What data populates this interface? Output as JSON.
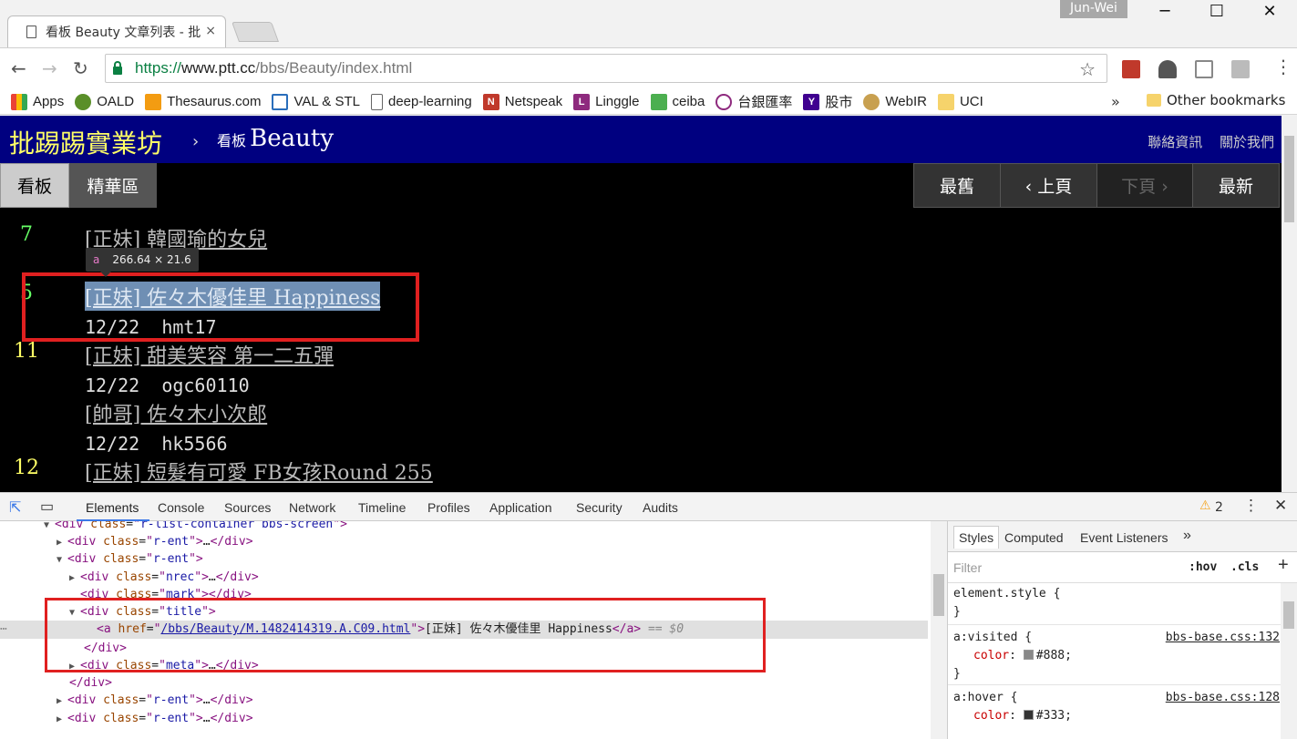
{
  "browser": {
    "tab_title": "看板 Beauty 文章列表 - 批",
    "tab_close": "×",
    "profile_name": "Jun-Wei",
    "window_minimize": "─",
    "window_maximize": "☐",
    "window_close": "✕",
    "url_scheme": "https://",
    "url_host": "www.ptt.cc",
    "url_path": "/bbs/Beauty/index.html",
    "bookmarks": [
      {
        "label": "Apps",
        "icon": "apps-grid-icon"
      },
      {
        "label": "OALD",
        "icon": "oald-icon"
      },
      {
        "label": "Thesaurus.com",
        "icon": "thesaurus-icon"
      },
      {
        "label": "VAL & STL",
        "icon": "val-stl-icon"
      },
      {
        "label": "deep-learning",
        "icon": "document-icon"
      },
      {
        "label": "Netspeak",
        "icon": "netspeak-icon"
      },
      {
        "label": "Linggle",
        "icon": "linggle-icon"
      },
      {
        "label": "ceiba",
        "icon": "ceiba-icon"
      },
      {
        "label": "台銀匯率",
        "icon": "bank-icon"
      },
      {
        "label": "股市",
        "icon": "yahoo-icon"
      },
      {
        "label": "WebIR",
        "icon": "webir-icon"
      },
      {
        "label": "UCI",
        "icon": "folder-icon"
      }
    ],
    "bookmarks_more": "»",
    "other_bookmarks": "Other bookmarks"
  },
  "ptt": {
    "site_title": "批踢踢實業坊",
    "crumb_sep": "›",
    "crumb_board_prefix": "看板",
    "crumb_board_name": "Beauty",
    "links": [
      "聯絡資訊",
      "關於我們"
    ],
    "board_tabs": [
      "看板",
      "精華區"
    ],
    "paging": [
      "最舊",
      "‹ 上頁",
      "下頁 ›",
      "最新"
    ],
    "posts": [
      {
        "nrec": "7",
        "nrec_color": "#66ff66",
        "title": "[正妹] 韓國瑜的女兒",
        "date": "",
        "author": ""
      },
      {
        "nrec": "5",
        "nrec_color": "#66ff66",
        "title": "[正妹] 佐々木優佳里 Happiness",
        "date": "12/22",
        "author": "hmt17"
      },
      {
        "nrec": "11",
        "nrec_color": "#ffff66",
        "title": "[正妹] 甜美笑容 第一二五彈",
        "date": "12/22",
        "author": "ogc60110"
      },
      {
        "nrec": "",
        "nrec_color": "#ffffff",
        "title": "[帥哥] 佐々木小次郎",
        "date": "12/22",
        "author": "hk5566"
      },
      {
        "nrec": "12",
        "nrec_color": "#ffff66",
        "title": "[正妹] 短髮有可愛 FB女孩Round 255",
        "date": "",
        "author": ""
      }
    ],
    "tooltip_tag": "a",
    "tooltip_dims": "266.64 × 21.6"
  },
  "devtools": {
    "tabs": [
      "Elements",
      "Console",
      "Sources",
      "Network",
      "Timeline",
      "Profiles",
      "Application",
      "Security",
      "Audits"
    ],
    "warning_count": "2",
    "dom": {
      "l0_tag": "div",
      "l0_attr": "class",
      "l0_val": "r-list-container bbs-screen",
      "r_ent": "r-ent",
      "nrec": "nrec",
      "mark": "mark",
      "title": "title",
      "meta": "meta",
      "href": "/bbs/Beauty/M.1482414319.A.C09.html",
      "link_text": "[正妹] 佐々木優佳里 Happiness",
      "dollar": "== $0",
      "ellipsis": "…"
    },
    "styles_tabs": [
      "Styles",
      "Computed",
      "Event Listeners"
    ],
    "styles_more": "»",
    "filter_placeholder": "Filter",
    "hov": ":hov",
    "cls": ".cls",
    "rules": [
      {
        "selector": "element.style {",
        "prop": "",
        "value": "",
        "source": ""
      },
      {
        "selector": "a:visited {",
        "prop": "color",
        "value": "#888;",
        "swatch": "#888888",
        "source": "bbs-base.css:132"
      },
      {
        "selector": "a:hover {",
        "prop": "color",
        "value": "#333;",
        "swatch": "#333333",
        "source": "bbs-base.css:128"
      }
    ]
  },
  "colors": {
    "ptt_navy": "#000080",
    "ptt_yellow": "#ffff66",
    "highlight_red": "#e02020"
  }
}
